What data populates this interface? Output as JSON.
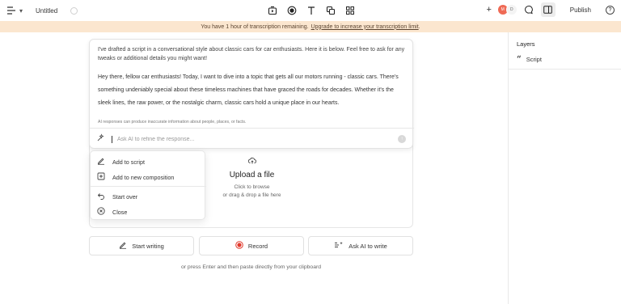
{
  "topbar": {
    "title": "Untitled",
    "publish_label": "Publish",
    "avatars": [
      "M",
      "D"
    ],
    "help_label": "?"
  },
  "banner": {
    "text": "You have 1 hour of transcription remaining.",
    "link": "Upgrade to increase your transcription limit"
  },
  "layers": {
    "title": "Layers",
    "items": [
      {
        "label": "Script",
        "icon": "quote-icon"
      }
    ]
  },
  "ai_response": {
    "intro": "I've drafted a script in a conversational style about classic cars for car enthusiasts. Here it is below. Feel free to ask for any tweaks or additional details you might want!",
    "script": "Hey there, fellow car enthusiasts! Today, I want to dive into a topic that gets all our motors running - classic cars. There's something undeniably special about these timeless machines that have graced the roads for decades. Whether it's the sleek lines, the raw power, or the nostalgic charm, classic cars hold a unique place in our hearts.",
    "disclaimer": "AI responses can produce inaccurate information about people, places, or facts.",
    "input_placeholder": "Ask AI to refine the response..."
  },
  "dropdown": {
    "items": [
      {
        "label": "Add to script",
        "icon": "pen-icon"
      },
      {
        "label": "Add to new composition",
        "icon": "add-composition-icon"
      },
      {
        "label": "Start over",
        "icon": "undo-icon"
      },
      {
        "label": "Close",
        "icon": "close-circle-icon"
      }
    ]
  },
  "upload": {
    "title": "Upload a file",
    "line1": "Click to browse",
    "line2": "or drag & drop a file here"
  },
  "actions": {
    "start_writing": "Start writing",
    "record": "Record",
    "ask_ai": "Ask AI to write",
    "hint": "or press Enter and then paste directly from your clipboard"
  },
  "colors": {
    "banner_bg": "#fbe6cf",
    "record_red": "#e23b2e",
    "avatar_orange": "#ef6a55"
  }
}
